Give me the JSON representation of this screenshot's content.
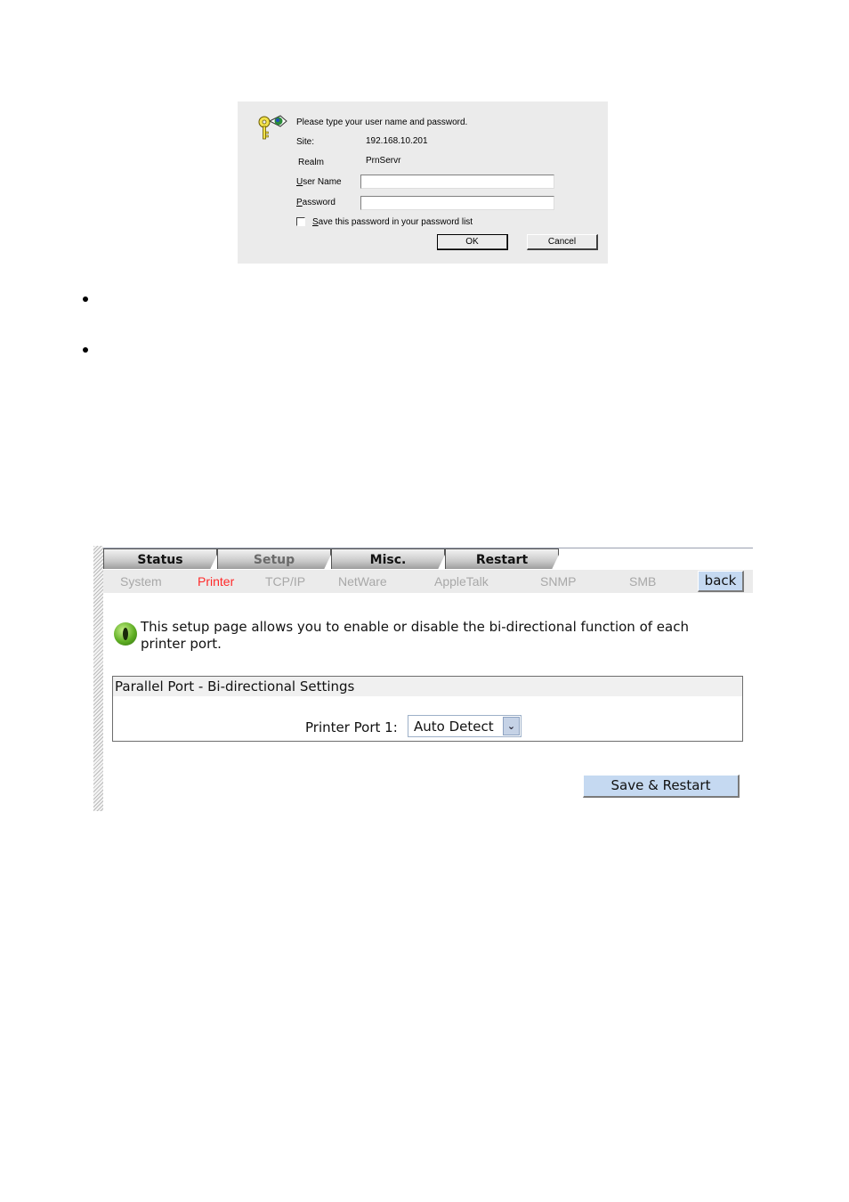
{
  "login_dialog": {
    "prompt": "Please type your user name and password.",
    "site_label": "Site:",
    "site_value": "192.168.10.201",
    "realm_label": "Realm",
    "realm_value": "PrnServr",
    "username_label_ul": "U",
    "username_label_rest": "ser Name",
    "username_value": "",
    "password_label_ul": "P",
    "password_label_rest": "assword",
    "password_value": "",
    "save_password_ul": "S",
    "save_password_rest": "ave this password in your password list",
    "save_password_checked": false,
    "ok_label": "OK",
    "cancel_label": "Cancel",
    "icon": "key-globe-icon"
  },
  "web_admin": {
    "tabs": [
      {
        "label": "Status",
        "active": false
      },
      {
        "label": "Setup",
        "active": true
      },
      {
        "label": "Misc.",
        "active": false
      },
      {
        "label": "Restart",
        "active": false
      }
    ],
    "subnav": [
      {
        "label": "System",
        "active": false
      },
      {
        "label": "Printer",
        "active": true
      },
      {
        "label": "TCP/IP",
        "active": false
      },
      {
        "label": "NetWare",
        "active": false
      },
      {
        "label": "AppleTalk",
        "active": false
      },
      {
        "label": "SNMP",
        "active": false
      },
      {
        "label": "SMB",
        "active": false
      }
    ],
    "back_label": "back",
    "description": "This setup page allows you to enable or disable the bi-directional function of each printer port.",
    "info_icon": "info-eye-icon",
    "panel_title": "Parallel Port - Bi-directional Settings",
    "port_label": "Printer Port 1:",
    "port_value": "Auto Detect",
    "save_label": "Save & Restart",
    "colors": {
      "active_subnav": "#ff2a2a",
      "button_bg": "#c5d9f1"
    }
  }
}
